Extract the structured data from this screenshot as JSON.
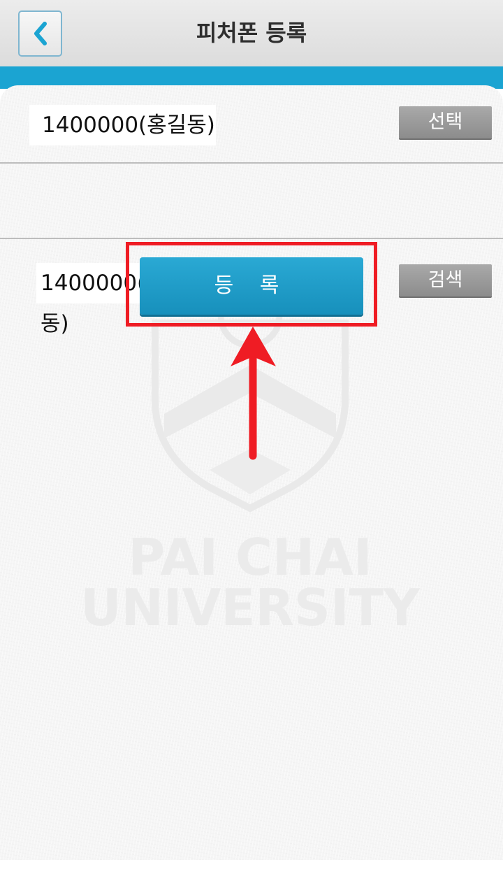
{
  "header": {
    "title": "피처폰 등록",
    "back_icon": "chevron-left-icon"
  },
  "form": {
    "row1": {
      "value": "1400000(홍길동)",
      "button_label": "선택"
    },
    "row2": {
      "value": "1400000(홍길동)",
      "button_label": "검색"
    },
    "register_label": "등 록"
  },
  "watermark": {
    "line1": "PAI CHAI",
    "line2": "UNIVERSITY"
  },
  "annotation": {
    "type": "highlight-box-with-arrow",
    "color": "#ef1c24"
  },
  "colors": {
    "accent": "#1ba4d2",
    "register_button": "#1f9cc8",
    "gray_button": "#9a9a9a",
    "highlight": "#ef1c24"
  }
}
